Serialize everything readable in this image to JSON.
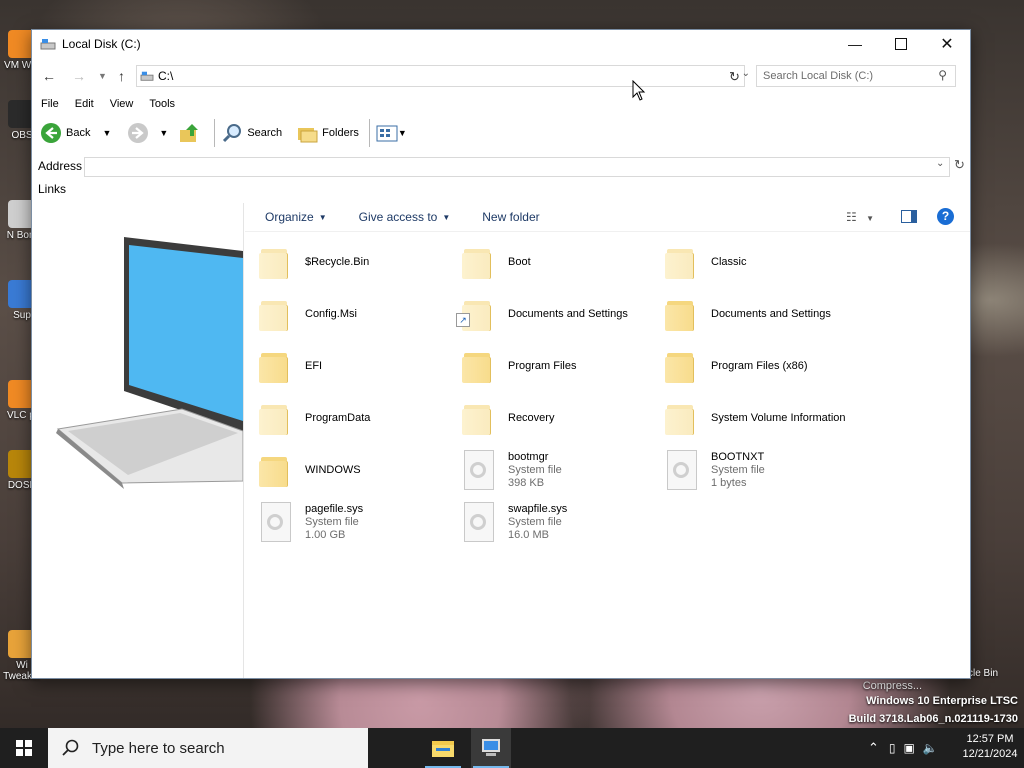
{
  "desktop": {
    "icons_left": [
      {
        "label": "VM Wor"
      },
      {
        "label": "OBS"
      },
      {
        "label": "N Bom"
      },
      {
        "label": "Sup"
      },
      {
        "label": "VLC pl"
      },
      {
        "label": "DOSB"
      },
      {
        "label": "Wi Tweaker"
      }
    ],
    "recycle_label": "cycle Bin",
    "watermark": {
      "line1": "Compress...",
      "line2": "Windows 10 Enterprise LTSC",
      "line3": "Build 3718.Lab06_n.021119-1730"
    }
  },
  "window": {
    "title": "Local Disk (C:)",
    "address_path": "C:\\",
    "search_placeholder": "Search Local Disk (C:)",
    "menu": [
      "File",
      "Edit",
      "View",
      "Tools"
    ],
    "toolbar": {
      "back": "Back",
      "search": "Search",
      "folders": "Folders"
    },
    "address_label": "Address",
    "links_label": "Links",
    "commands": {
      "organize": "Organize",
      "give_access": "Give access to",
      "new_folder": "New folder"
    },
    "items": [
      {
        "name": "$Recycle.Bin",
        "type": "folder",
        "pale": true
      },
      {
        "name": "Boot",
        "type": "folder",
        "pale": true
      },
      {
        "name": "Classic",
        "type": "folder",
        "pale": true
      },
      {
        "name": "Config.Msi",
        "type": "folder",
        "pale": true
      },
      {
        "name": "Documents and Settings",
        "type": "folder",
        "pale": true,
        "shortcut": true
      },
      {
        "name": "Documents and Settings",
        "type": "folder",
        "pale": false
      },
      {
        "name": "EFI",
        "type": "folder",
        "pale": false
      },
      {
        "name": "Program Files",
        "type": "folder",
        "pale": false
      },
      {
        "name": "Program Files (x86)",
        "type": "folder",
        "pale": false
      },
      {
        "name": "ProgramData",
        "type": "folder",
        "pale": true
      },
      {
        "name": "Recovery",
        "type": "folder",
        "pale": true
      },
      {
        "name": "System Volume Information",
        "type": "folder",
        "pale": true
      },
      {
        "name": "WINDOWS",
        "type": "folder",
        "pale": false
      },
      {
        "name": "bootmgr",
        "type": "file",
        "kind": "System file",
        "size": "398 KB"
      },
      {
        "name": "BOOTNXT",
        "type": "file",
        "kind": "System file",
        "size": "1 bytes"
      },
      {
        "name": "pagefile.sys",
        "type": "file",
        "kind": "System file",
        "size": "1.00 GB"
      },
      {
        "name": "swapfile.sys",
        "type": "file",
        "kind": "System file",
        "size": "16.0 MB"
      }
    ]
  },
  "taskbar": {
    "search_placeholder": "Type here to search",
    "time": "12:57 PM",
    "date": "12/21/2024"
  }
}
